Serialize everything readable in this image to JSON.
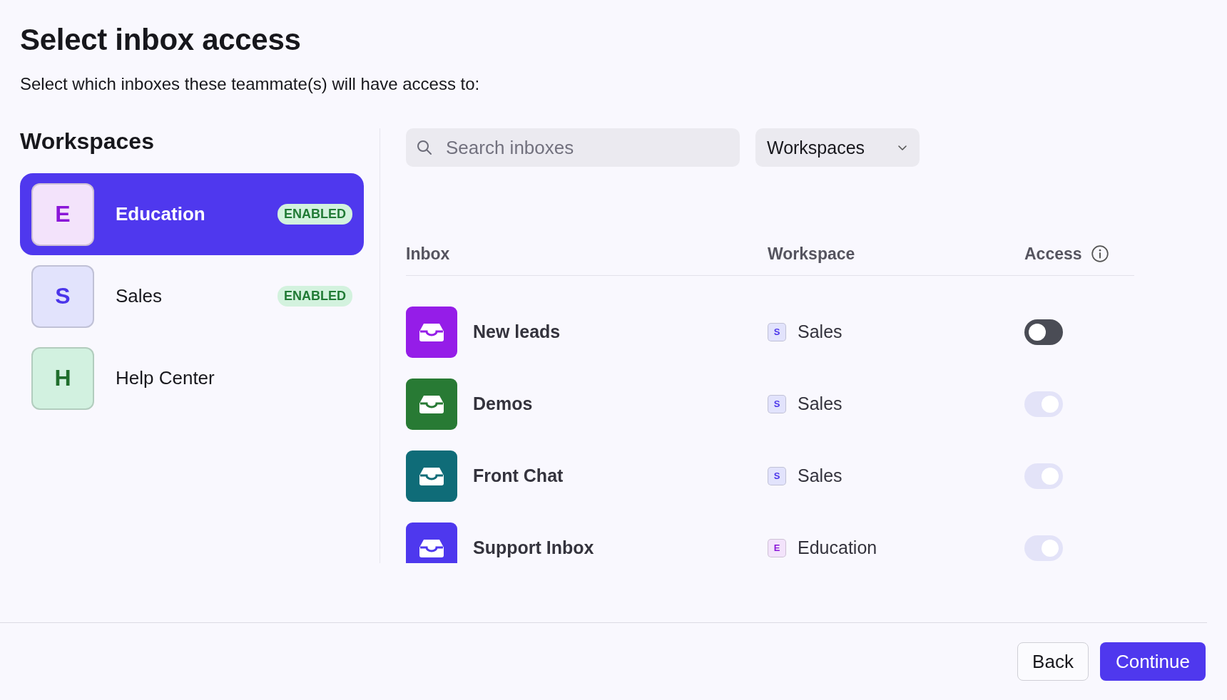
{
  "title": "Select inbox access",
  "subtitle": "Select which inboxes these teammate(s) will have access to:",
  "sidebar": {
    "heading": "Workspaces",
    "items": [
      {
        "letter": "E",
        "name": "Education",
        "badge": "ENABLED",
        "selected": true,
        "color": "#f3e3fb"
      },
      {
        "letter": "S",
        "name": "Sales",
        "badge": "ENABLED",
        "selected": false,
        "color": "#e2e3fc"
      },
      {
        "letter": "H",
        "name": "Help Center",
        "selected": false,
        "color": "#d2f1e0"
      }
    ]
  },
  "search": {
    "placeholder": "Search inboxes"
  },
  "filter": {
    "value": "Workspaces"
  },
  "table": {
    "columns": [
      "Inbox",
      "Workspace",
      "Access"
    ],
    "rows": [
      {
        "inbox": "New leads",
        "color": "#951de8",
        "workspace_letter": "S",
        "workspace": "Sales",
        "on": false,
        "disabled": false
      },
      {
        "inbox": "Demos",
        "color": "#287a34",
        "workspace_letter": "S",
        "workspace": "Sales",
        "on": true,
        "disabled": true
      },
      {
        "inbox": "Front Chat",
        "color": "#0f6c78",
        "workspace_letter": "S",
        "workspace": "Sales",
        "on": true,
        "disabled": true
      },
      {
        "inbox": "Support Inbox",
        "color": "#4e38ee",
        "workspace_letter": "E",
        "workspace": "Education",
        "on": true,
        "disabled": true
      }
    ]
  },
  "buttons": [
    {
      "label": "Back",
      "kind": "secondary"
    },
    {
      "label": "Continue",
      "kind": "primary"
    }
  ]
}
